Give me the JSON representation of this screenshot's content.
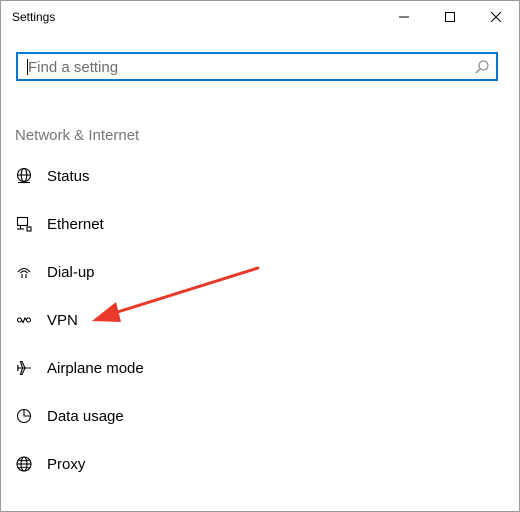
{
  "window": {
    "title": "Settings",
    "controls": [
      "minimize-icon",
      "maximize-icon",
      "close-icon"
    ]
  },
  "search": {
    "placeholder": "Find a setting",
    "icon": "search-icon"
  },
  "section": {
    "title": "Network & Internet"
  },
  "nav": {
    "items": [
      {
        "label": "Status",
        "icon": "status-globe-icon"
      },
      {
        "label": "Ethernet",
        "icon": "ethernet-icon"
      },
      {
        "label": "Dial-up",
        "icon": "dialup-icon"
      },
      {
        "label": "VPN",
        "icon": "vpn-icon"
      },
      {
        "label": "Airplane mode",
        "icon": "airplane-icon"
      },
      {
        "label": "Data usage",
        "icon": "data-usage-icon"
      },
      {
        "label": "Proxy",
        "icon": "proxy-globe-icon"
      }
    ]
  },
  "colors": {
    "accent": "#0078d7",
    "section_text": "#767676",
    "annotation_arrow": "#e8392a"
  }
}
